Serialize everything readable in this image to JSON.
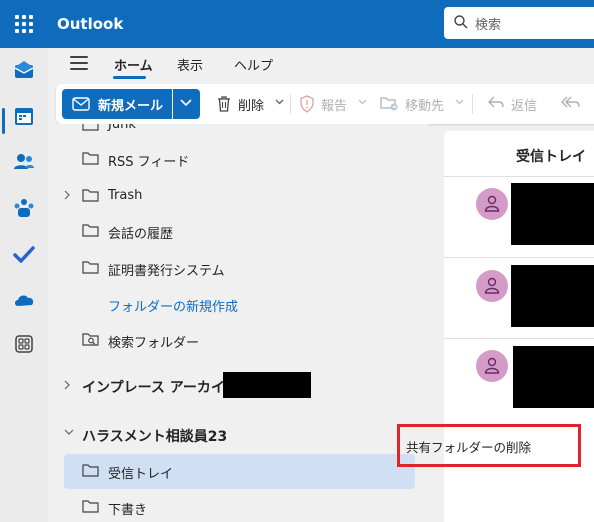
{
  "app": {
    "title": "Outlook"
  },
  "search": {
    "placeholder": "検索"
  },
  "rail": {
    "items": [
      "mail-icon",
      "calendar-icon",
      "people-icon",
      "groups-icon",
      "todo-icon",
      "onedrive-icon",
      "apps-icon"
    ]
  },
  "tabs": [
    {
      "label": "ホーム",
      "active": true
    },
    {
      "label": "表示",
      "active": false
    },
    {
      "label": "ヘルプ",
      "active": false
    }
  ],
  "ribbon": {
    "new_mail": "新規メール",
    "delete": "削除",
    "report": "報告",
    "move_to": "移動先",
    "reply": "返信"
  },
  "folders": {
    "partial_top": "Junk",
    "items": [
      {
        "label": "RSS フィード",
        "icon": "folder-icon",
        "expandable": false
      },
      {
        "label": "Trash",
        "icon": "folder-icon",
        "expandable": true
      },
      {
        "label": "会話の履歴",
        "icon": "folder-icon",
        "expandable": false
      },
      {
        "label": "証明書発行システム",
        "icon": "folder-icon",
        "expandable": false
      }
    ],
    "new_folder_link": "フォルダーの新規作成",
    "search_folder": "検索フォルダー",
    "archive_section": "インプレース アーカイブ",
    "shared_section": "ハラスメント相談員23",
    "shared_items": [
      {
        "label": "受信トレイ",
        "selected": true
      },
      {
        "label": "下書き",
        "selected": false
      }
    ]
  },
  "message_list": {
    "title": "受信トレイ"
  },
  "context_menu": {
    "item": "共有フォルダーの削除",
    "highlight_color": "#e0242d"
  },
  "colors": {
    "brand": "#0f6cbd",
    "selected": "#cfe0f5",
    "avatar": "#d59bc8"
  }
}
